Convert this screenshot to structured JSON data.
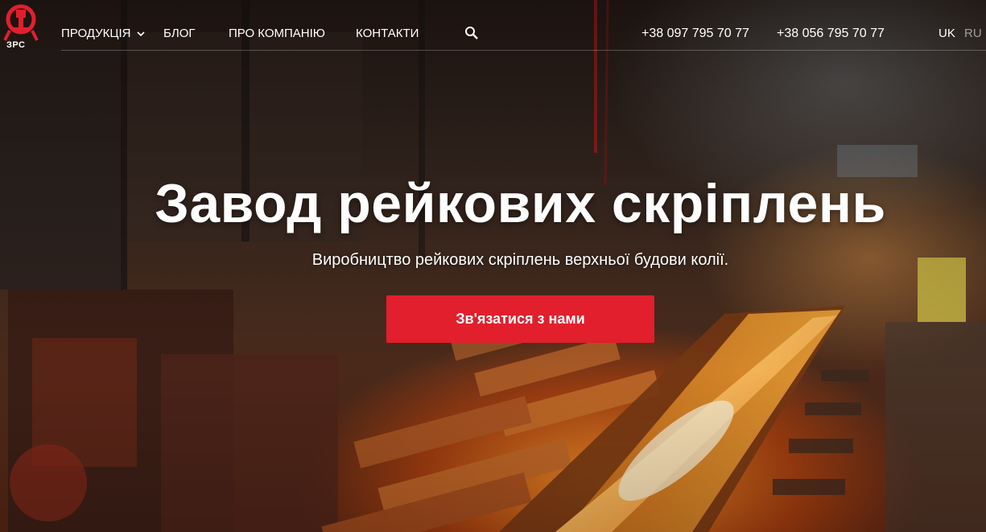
{
  "header": {
    "logo_text": "ЗРС",
    "nav": {
      "products": "ПРОДУКЦІЯ",
      "blog": "БЛОГ",
      "about": "ПРО КОМПАНІЮ",
      "contacts": "КОНТАКТИ"
    },
    "phones": [
      "+38 097 795 70 77",
      "+38 056 795 70 77"
    ],
    "languages": {
      "uk": "UK",
      "ru": "RU"
    },
    "icons": {
      "search": "search-icon",
      "chevron": "chevron-down-icon",
      "logo": "rail-logo-icon"
    }
  },
  "hero": {
    "title": "Завод рейкових скріплень",
    "subtitle": "Виробництво рейкових скріплень верхньої будови колії.",
    "cta_label": "Зв'язатися з нами"
  },
  "colors": {
    "accent": "#e11f2d",
    "text": "#ffffff"
  }
}
